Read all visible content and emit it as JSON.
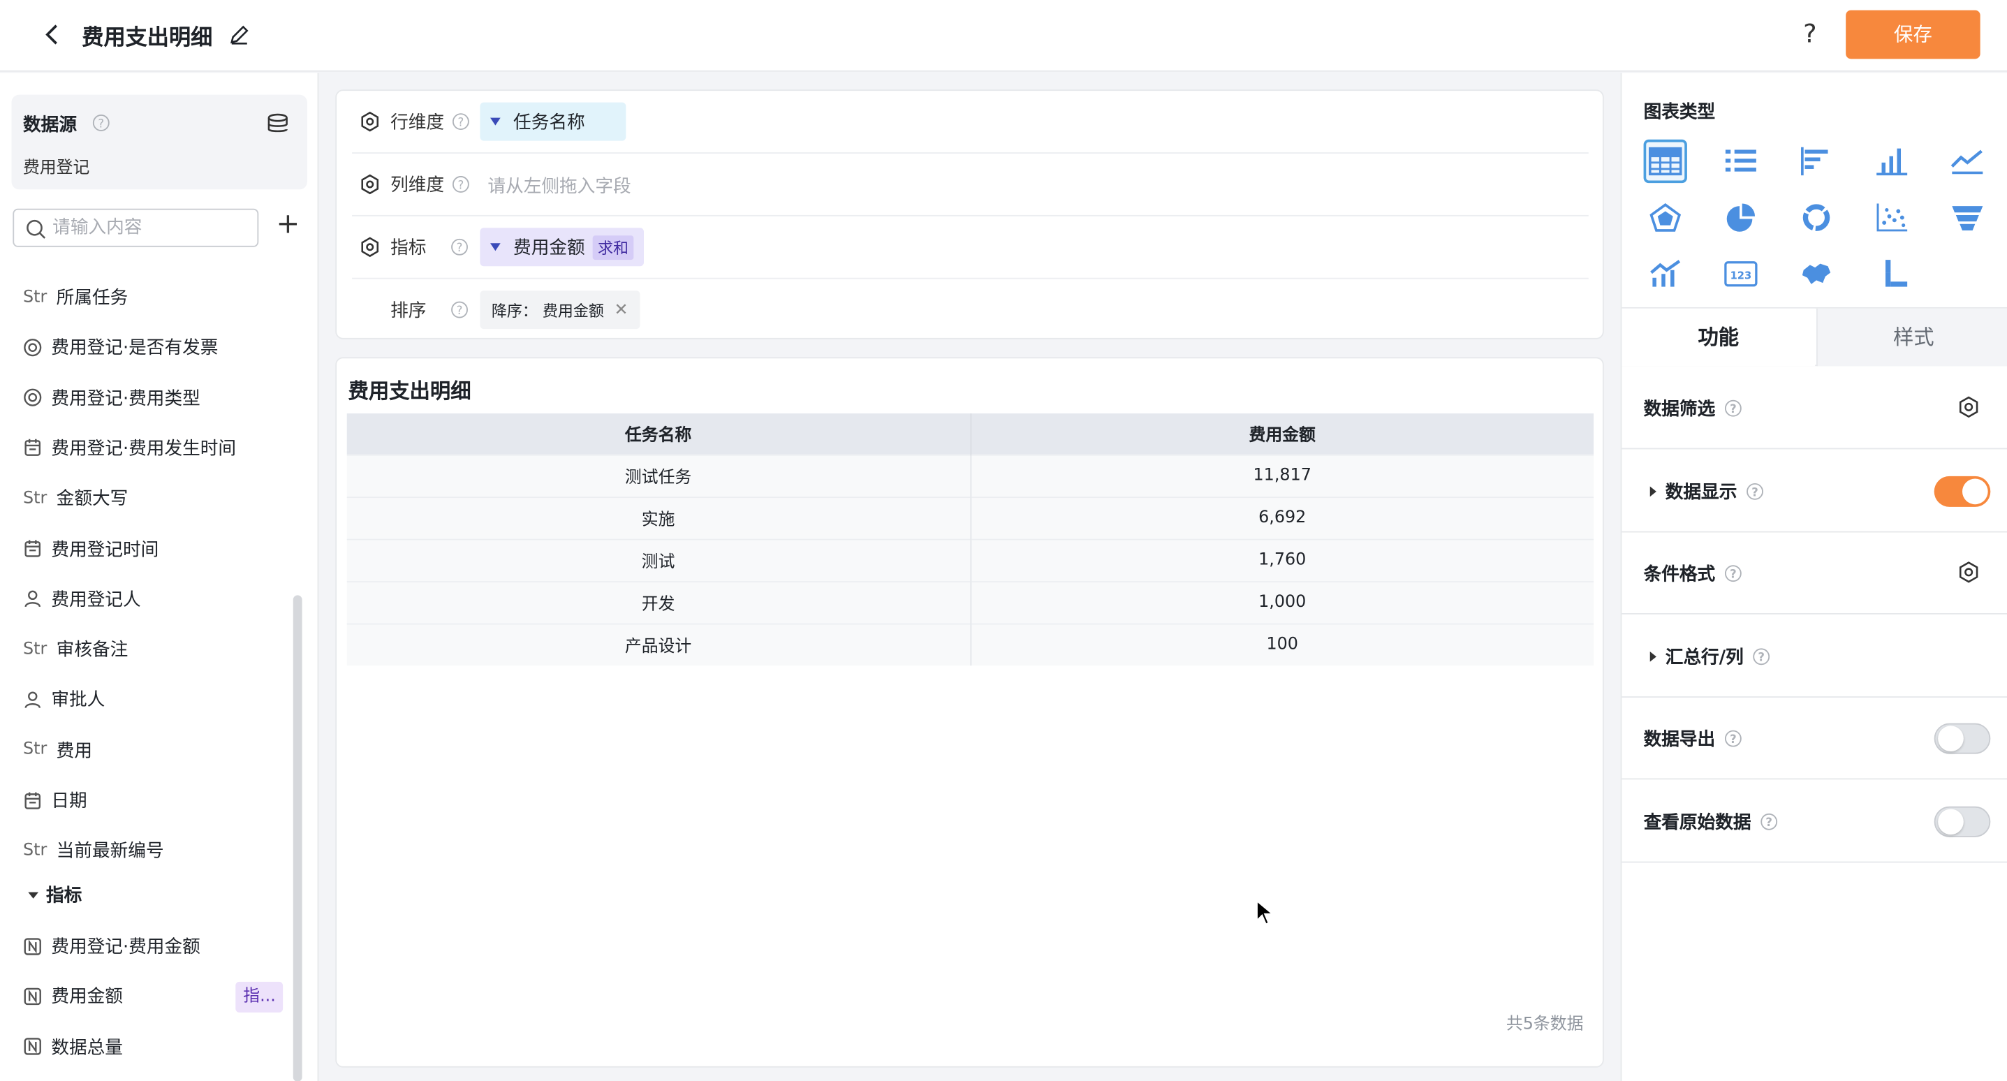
{
  "header": {
    "title": "费用支出明细",
    "help": "?",
    "save_label": "保存"
  },
  "left": {
    "datasource_label": "数据源",
    "datasource_name": "费用登记",
    "search_placeholder": "请输入内容",
    "fields": [
      {
        "type": "Str",
        "icon": "str",
        "label": "所属任务"
      },
      {
        "type": "",
        "icon": "radio-icon",
        "label": "费用登记·是否有发票"
      },
      {
        "type": "",
        "icon": "radio-icon",
        "label": "费用登记·费用类型"
      },
      {
        "type": "",
        "icon": "calendar-icon",
        "label": "费用登记·费用发生时间"
      },
      {
        "type": "Str",
        "icon": "str",
        "label": "金额大写"
      },
      {
        "type": "",
        "icon": "calendar-icon",
        "label": "费用登记时间"
      },
      {
        "type": "",
        "icon": "user-icon",
        "label": "费用登记人"
      },
      {
        "type": "Str",
        "icon": "str",
        "label": "审核备注"
      },
      {
        "type": "",
        "icon": "user-icon",
        "label": "审批人"
      },
      {
        "type": "Str",
        "icon": "str",
        "label": "费用"
      },
      {
        "type": "",
        "icon": "calendar-icon",
        "label": "日期"
      },
      {
        "type": "Str",
        "icon": "str",
        "label": "当前最新编号"
      }
    ],
    "metrics_group": "指标",
    "metrics": [
      {
        "icon": "number-icon",
        "label": "费用登记·费用金额"
      },
      {
        "icon": "number-icon",
        "label": "费用金额",
        "tag": "指..."
      },
      {
        "icon": "number-icon",
        "label": "数据总量"
      }
    ]
  },
  "config": {
    "row_dim_label": "行维度",
    "row_dim_value": "任务名称",
    "col_dim_label": "列维度",
    "col_dim_placeholder": "请从左侧拖入字段",
    "metric_label": "指标",
    "metric_value": "费用金额",
    "metric_agg": "求和",
    "sort_label": "排序",
    "sort_value": "降序：  费用金额"
  },
  "table": {
    "title": "费用支出明细",
    "columns": [
      "任务名称",
      "费用金额"
    ],
    "rows": [
      [
        "测试任务",
        "11,817"
      ],
      [
        "实施",
        "6,692"
      ],
      [
        "测试",
        "1,760"
      ],
      [
        "开发",
        "1,000"
      ],
      [
        "产品设计",
        "100"
      ]
    ],
    "total": "共5条数据"
  },
  "right": {
    "chart_type_label": "图表类型",
    "tabs": [
      "功能",
      "样式"
    ],
    "options": [
      {
        "label": "数据筛选",
        "control": "gear"
      },
      {
        "label": "数据显示",
        "control": "toggle",
        "on": true,
        "expandable": true
      },
      {
        "label": "条件格式",
        "control": "gear"
      },
      {
        "label": "汇总行/列",
        "control": "none",
        "expandable": true
      },
      {
        "label": "数据导出",
        "control": "toggle",
        "on": false
      },
      {
        "label": "查看原始数据",
        "control": "toggle",
        "on": false
      }
    ]
  },
  "colors": {
    "accent": "#f7883d",
    "chart_icon": "#4b8fe0",
    "selected_border": "#4b9fe0"
  }
}
